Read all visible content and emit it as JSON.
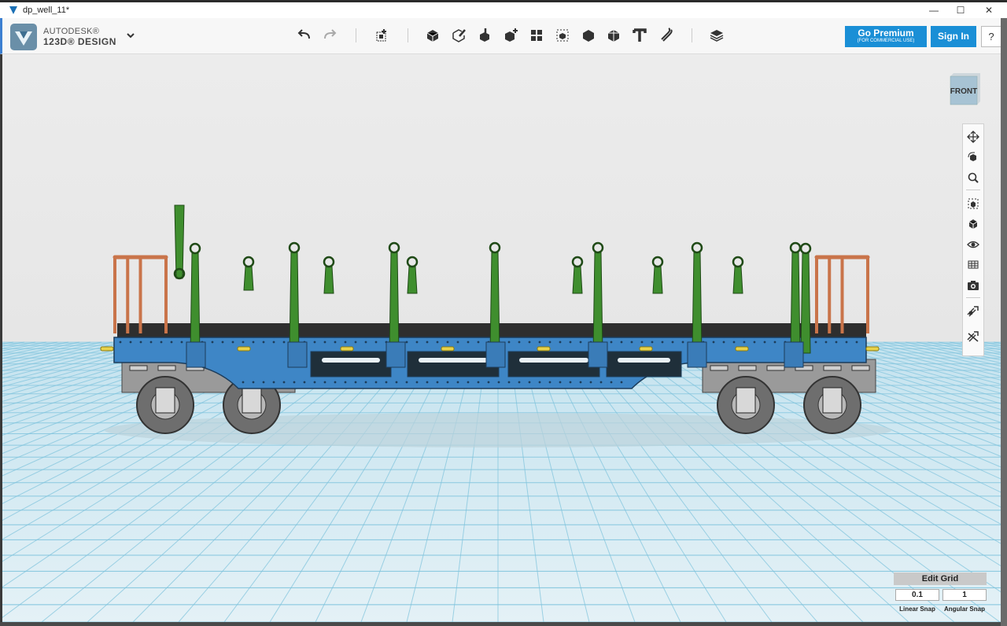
{
  "window": {
    "title": "dp_well_11*",
    "minimize": "—",
    "maximize": "☐",
    "close": "✕"
  },
  "brand": {
    "line1": "AUTODESK®",
    "line2": "123D® DESIGN"
  },
  "toolbar": {
    "icons": [
      "undo-icon",
      "redo-icon",
      "transform-icon",
      "primitives-icon",
      "sketch-icon",
      "construct-icon",
      "modify-icon",
      "pattern-icon",
      "group-icon",
      "combine-icon",
      "measure-icon",
      "text-icon",
      "snap-icon",
      "material-icon"
    ]
  },
  "account": {
    "premium_label": "Go Premium",
    "premium_sub": "(FOR COMMERCIAL USE)",
    "signin_label": "Sign In",
    "help_label": "?"
  },
  "viewcube": {
    "face": "FRONT"
  },
  "navbar": {
    "icons": [
      "pan-icon",
      "orbit-icon",
      "zoom-icon",
      "fit-icon",
      "perspective-icon",
      "visibility-icon",
      "materials-icon",
      "snapshot-icon",
      "grid-snap-icon",
      "grid-visibility-icon"
    ]
  },
  "grid": {
    "edit_label": "Edit Grid",
    "linear_value": "0.1",
    "angular_value": "1",
    "linear_label": "Linear Snap",
    "angular_label": "Angular Snap"
  },
  "colors": {
    "accent": "#1a8fd6",
    "frame": "#3e86c6",
    "stakes": "#3f8e2e",
    "rails": "#c9744a"
  }
}
